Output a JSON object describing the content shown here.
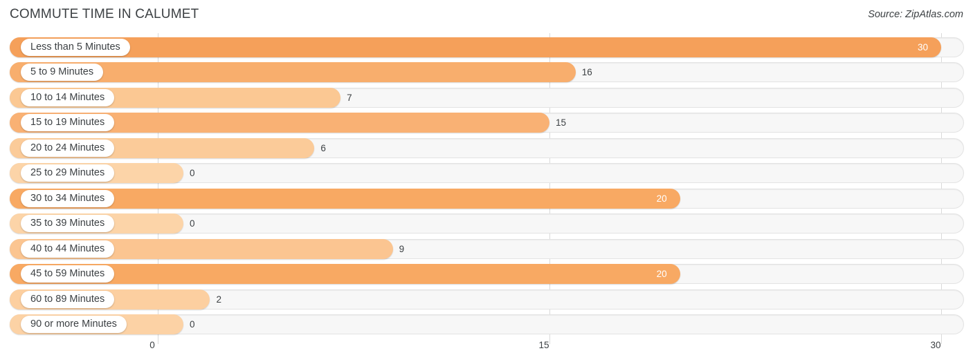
{
  "header": {
    "title": "COMMUTE TIME IN CALUMET",
    "source": "Source: ZipAtlas.com"
  },
  "chart_data": {
    "type": "bar",
    "orientation": "horizontal",
    "title": "COMMUTE TIME IN CALUMET",
    "subtitle": "",
    "xlabel": "",
    "ylabel": "",
    "xlim": [
      0,
      30
    ],
    "grid": true,
    "legend": null,
    "xticks": [
      "0",
      "15",
      "30"
    ],
    "xtick_values": [
      0,
      15,
      30
    ],
    "categories": [
      "Less than 5 Minutes",
      "5 to 9 Minutes",
      "10 to 14 Minutes",
      "15 to 19 Minutes",
      "20 to 24 Minutes",
      "25 to 29 Minutes",
      "30 to 34 Minutes",
      "35 to 39 Minutes",
      "40 to 44 Minutes",
      "45 to 59 Minutes",
      "60 to 89 Minutes",
      "90 or more Minutes"
    ],
    "values": [
      30,
      16,
      7,
      15,
      6,
      0,
      20,
      0,
      9,
      20,
      2,
      0
    ],
    "value_labels": [
      "30",
      "16",
      "7",
      "15",
      "6",
      "0",
      "20",
      "0",
      "9",
      "20",
      "2",
      "0"
    ],
    "bars": [
      {
        "label": "Less than 5 Minutes",
        "value": 30,
        "value_label": "30",
        "color": "#f5a05a",
        "label_inside": true
      },
      {
        "label": "5 to 9 Minutes",
        "value": 16,
        "value_label": "16",
        "color": "#f8ae6d",
        "label_inside": false
      },
      {
        "label": "10 to 14 Minutes",
        "value": 7,
        "value_label": "7",
        "color": "#fbc893",
        "label_inside": false
      },
      {
        "label": "15 to 19 Minutes",
        "value": 15,
        "value_label": "15",
        "color": "#f9b174",
        "label_inside": false
      },
      {
        "label": "20 to 24 Minutes",
        "value": 6,
        "value_label": "6",
        "color": "#fbcb99",
        "label_inside": false
      },
      {
        "label": "25 to 29 Minutes",
        "value": 0,
        "value_label": "0",
        "color": "#fcd4a8",
        "label_inside": false
      },
      {
        "label": "30 to 34 Minutes",
        "value": 20,
        "value_label": "20",
        "color": "#f8a963",
        "label_inside": true
      },
      {
        "label": "35 to 39 Minutes",
        "value": 0,
        "value_label": "0",
        "color": "#fcd4a8",
        "label_inside": false
      },
      {
        "label": "40 to 44 Minutes",
        "value": 9,
        "value_label": "9",
        "color": "#fbc591",
        "label_inside": false
      },
      {
        "label": "45 to 59 Minutes",
        "value": 20,
        "value_label": "20",
        "color": "#f8a963",
        "label_inside": true
      },
      {
        "label": "60 to 89 Minutes",
        "value": 2,
        "value_label": "2",
        "color": "#fccfa0",
        "label_inside": false
      },
      {
        "label": "90 or more Minutes",
        "value": 0,
        "value_label": "0",
        "color": "#fcd2a5",
        "label_inside": false
      }
    ],
    "colors": {
      "bar_high": "#f5a05a",
      "bar_low": "#fcd4a8",
      "track": "#f7f7f7",
      "track_border": "#e3e3e3",
      "gridline": "#d9d9d9",
      "text": "#3c4043",
      "value_inside": "#ffffff"
    }
  }
}
